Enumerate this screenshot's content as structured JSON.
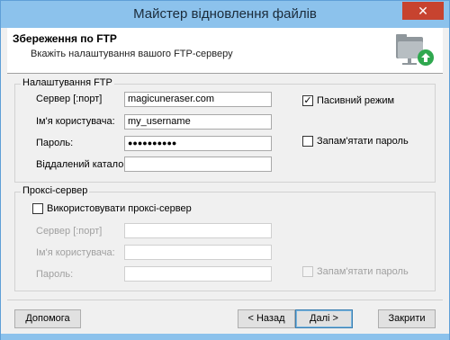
{
  "window": {
    "title": "Майстер відновлення файлів",
    "close_glyph": "✕"
  },
  "header": {
    "title": "Збереження по FTP",
    "subtitle": "Вкажіть налаштування вашого FTP-серверу",
    "icon": "folder-network-icon"
  },
  "ftp": {
    "legend": "Налаштування FTP",
    "server_label": "Сервер [:порт]",
    "server_value": "magicuneraser.com",
    "user_label": "Ім'я користувача:",
    "user_value": "my_username",
    "password_label": "Пароль:",
    "password_value": "●●●●●●●●●●",
    "remote_dir_label": "Віддалений каталог:",
    "remote_dir_value": "",
    "passive_label": "Пасивний режим",
    "passive_checked": true,
    "remember_label": "Запам'ятати пароль",
    "remember_checked": false
  },
  "proxy": {
    "legend": "Проксі-сервер",
    "use_label": "Використовувати проксі-сервер",
    "use_checked": false,
    "server_label": "Сервер [:порт]",
    "user_label": "Ім'я користувача:",
    "password_label": "Пароль:",
    "remember_label": "Запам'ятати пароль"
  },
  "buttons": {
    "help": "Допомога",
    "back": "< Назад",
    "next": "Далі >",
    "cancel": "Закрити"
  },
  "colors": {
    "titlebar": "#8cc2ec",
    "close": "#c7432f",
    "accent": "#3c7fb1"
  }
}
